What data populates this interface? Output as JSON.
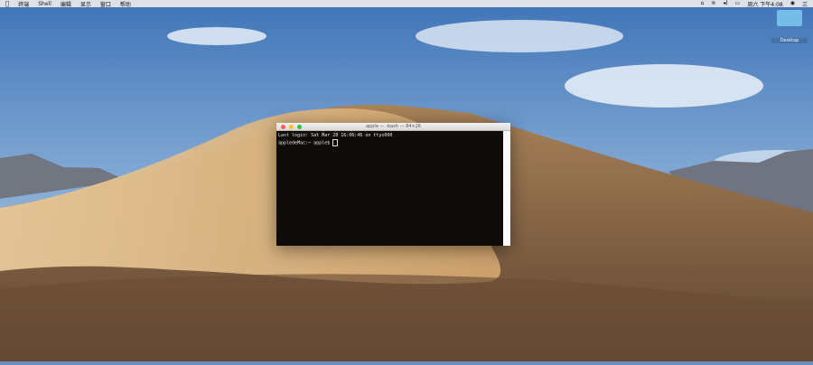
{
  "menubar": {
    "apple_icon": "apple-icon",
    "items": [
      "终端",
      "Shell",
      "编辑",
      "显示",
      "窗口",
      "帮助"
    ],
    "status": {
      "clock": "周六 下午4:08",
      "right_text": "三"
    }
  },
  "desktop": {
    "folder_label": "Desktop"
  },
  "terminal": {
    "title": "apple — -bash — 84×26",
    "lines": [
      "Last login: Sat Mar 28 16:06:46 on ttys000",
      "appledeMac:~ apple$ "
    ]
  }
}
